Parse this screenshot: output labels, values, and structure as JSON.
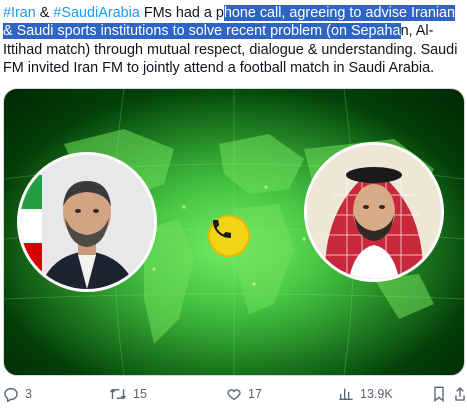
{
  "tweet": {
    "hashtag_iran": "#Iran",
    "text_amp": " & ",
    "hashtag_saudi": "#SaudiArabia",
    "text_pre": " FMs had a p",
    "text_selected": "hone call, agreeing to advise Iranian & Saudi sports institutions to solve recent problem (on Sepaha",
    "text_post": "n, Al-Ittihad match) through mutual respect, dialogue & understanding. Saudi FM invited Iran FM to jointly attend a football match in Saudi Arabia."
  },
  "media": {
    "left_person": "iranian-foreign-minister-portrait",
    "right_person": "saudi-foreign-minister-portrait",
    "center_icon": "phone-icon",
    "background": "green-world-map",
    "colors": {
      "badge": "#f2d417",
      "map": "#17a424"
    }
  },
  "actions": {
    "reply_count": "3",
    "retweet_count": "15",
    "like_count": "17",
    "views_count": "13.9K"
  },
  "icons": [
    "reply-icon",
    "retweet-icon",
    "like-icon",
    "views-icon",
    "bookmark-icon",
    "share-icon"
  ],
  "colors": {
    "hashtag": "#1d9bf0",
    "selection": "#2f64c7",
    "muted": "#536471"
  }
}
